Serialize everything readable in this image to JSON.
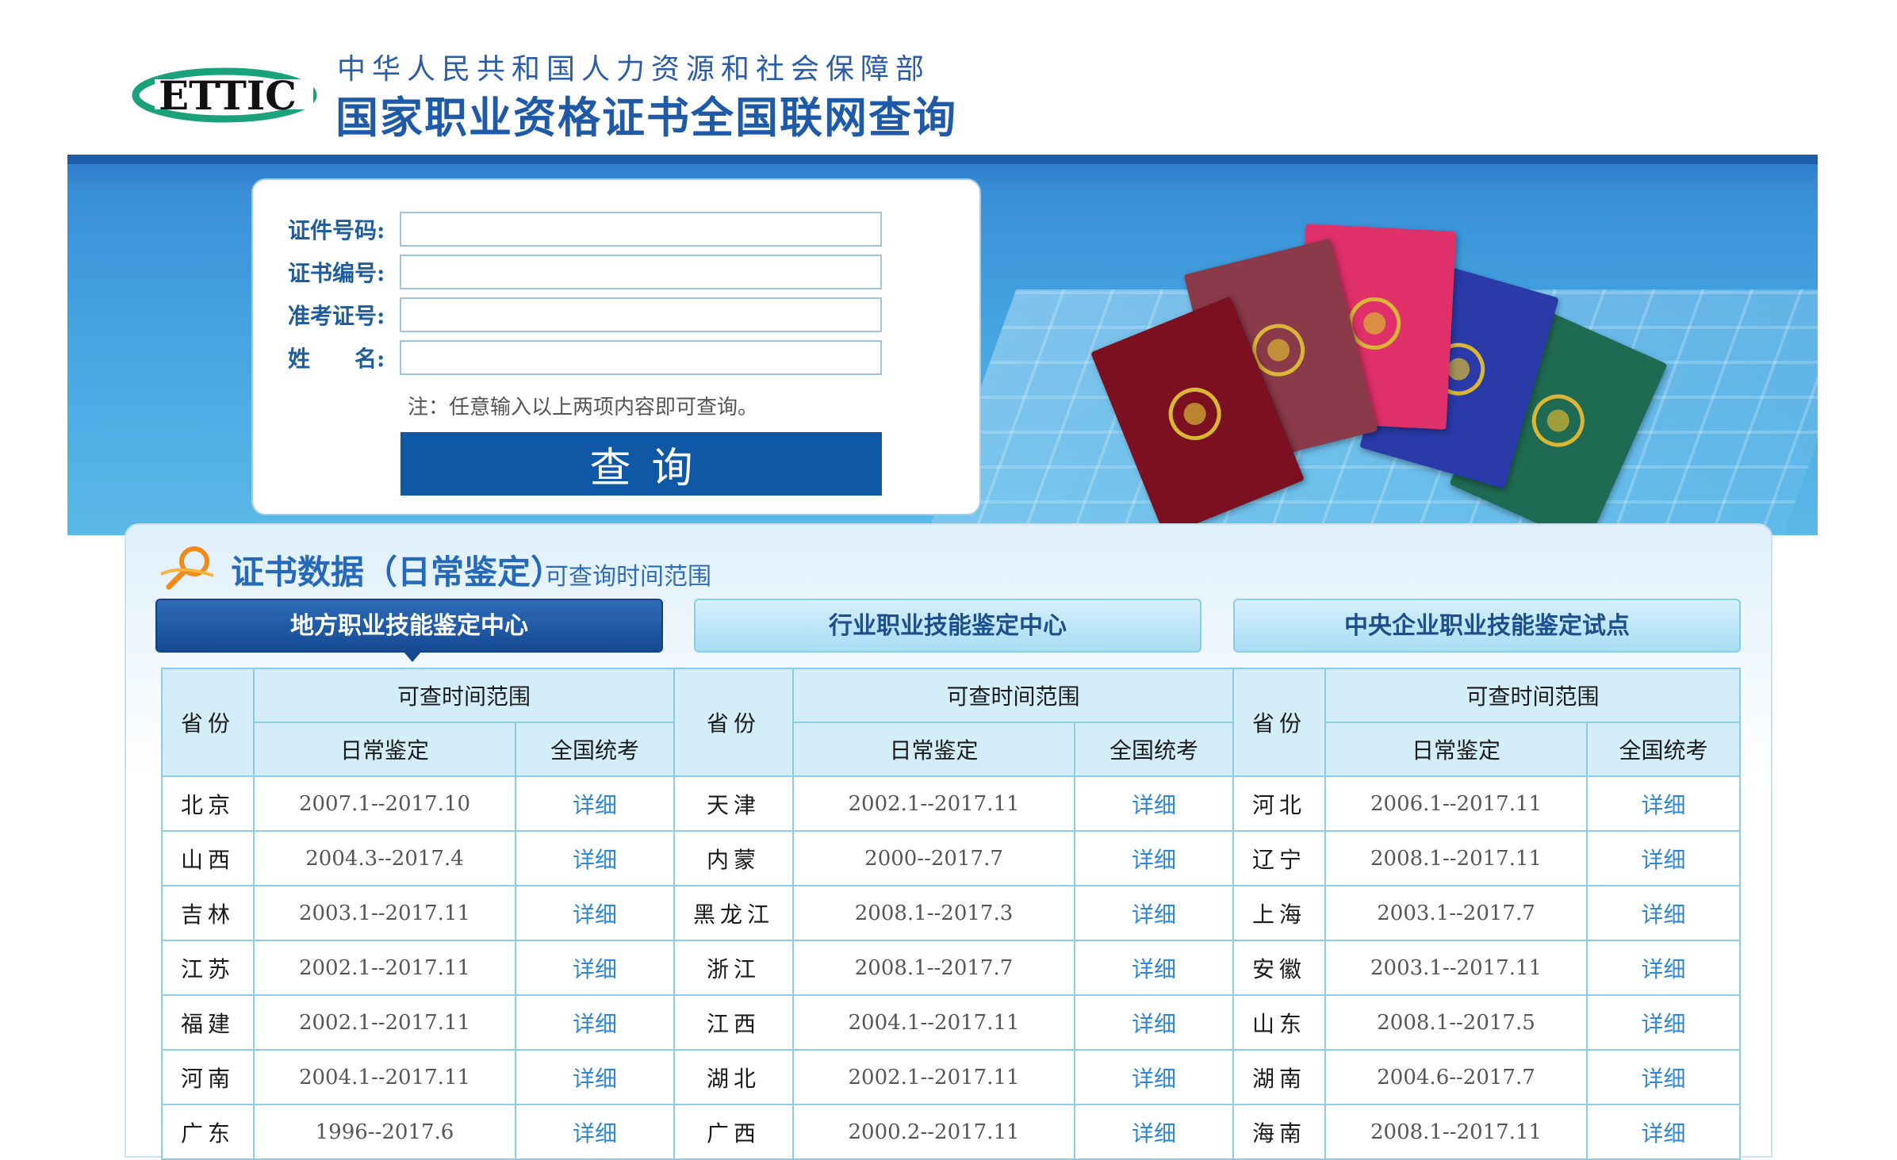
{
  "header": {
    "logo_text": "ETTIC",
    "dept": "中华人民共和国人力资源和社会保障部",
    "title": "国家职业资格证书全国联网查询"
  },
  "form": {
    "fields": [
      {
        "label": "证件号码:",
        "value": ""
      },
      {
        "label": "证书编号:",
        "value": ""
      },
      {
        "label": "准考证号:",
        "value": ""
      },
      {
        "label": "姓　　名:",
        "value": ""
      }
    ],
    "note": "注：任意输入以上两项内容即可查询。",
    "button": "查询"
  },
  "section": {
    "title": "证书数据（日常鉴定）",
    "subtitle": "可查询时间范围",
    "tabs": [
      "地方职业技能鉴定中心",
      "行业职业技能鉴定中心",
      "中央企业职业技能鉴定试点"
    ],
    "active_tab": 0
  },
  "table": {
    "head_province": "省份",
    "head_range": "可查时间范围",
    "head_daily": "日常鉴定",
    "head_national": "全国统考",
    "detail_label": "详细",
    "rows": [
      [
        {
          "p": "北京",
          "r": "2007.1--2017.10"
        },
        {
          "p": "天津",
          "r": "2002.1--2017.11"
        },
        {
          "p": "河北",
          "r": "2006.1--2017.11"
        }
      ],
      [
        {
          "p": "山西",
          "r": "2004.3--2017.4"
        },
        {
          "p": "内蒙",
          "r": "2000--2017.7"
        },
        {
          "p": "辽宁",
          "r": "2008.1--2017.11"
        }
      ],
      [
        {
          "p": "吉林",
          "r": "2003.1--2017.11"
        },
        {
          "p": "黑龙江",
          "r": "2008.1--2017.3"
        },
        {
          "p": "上海",
          "r": "2003.1--2017.7"
        }
      ],
      [
        {
          "p": "江苏",
          "r": "2002.1--2017.11"
        },
        {
          "p": "浙江",
          "r": "2008.1--2017.7"
        },
        {
          "p": "安徽",
          "r": "2003.1--2017.11"
        }
      ],
      [
        {
          "p": "福建",
          "r": "2002.1--2017.11"
        },
        {
          "p": "江西",
          "r": "2004.1--2017.11"
        },
        {
          "p": "山东",
          "r": "2008.1--2017.5"
        }
      ],
      [
        {
          "p": "河南",
          "r": "2004.1--2017.11"
        },
        {
          "p": "湖北",
          "r": "2002.1--2017.11"
        },
        {
          "p": "湖南",
          "r": "2004.6--2017.7"
        }
      ],
      [
        {
          "p": "广东",
          "r": "1996--2017.6"
        },
        {
          "p": "广西",
          "r": "2000.2--2017.11"
        },
        {
          "p": "海南",
          "r": "2008.1--2017.11"
        }
      ]
    ]
  },
  "colors": {
    "brand_blue": "#0f58a5",
    "link_blue": "#2f87d6",
    "table_border": "#8ccde6",
    "header_cell": "#d4eef9",
    "cert_colors": [
      "#7a1020",
      "#8a3a48",
      "#e0306a",
      "#2a3aa8",
      "#1f6a52"
    ]
  }
}
